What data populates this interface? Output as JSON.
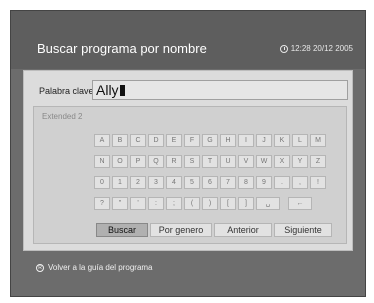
{
  "header": {
    "title": "Buscar programa por nombre",
    "datetime": "12:28 20/12 2005"
  },
  "keyword": {
    "label": "Palabra clave",
    "value": "Ally"
  },
  "keyboard": {
    "mode": "Extended 2",
    "rows": [
      [
        "A",
        "B",
        "C",
        "D",
        "E",
        "F",
        "G",
        "H",
        "I",
        "J",
        "K",
        "L",
        "M"
      ],
      [
        "N",
        "O",
        "P",
        "Q",
        "R",
        "S",
        "T",
        "U",
        "V",
        "W",
        "X",
        "Y",
        "Z"
      ],
      [
        "0",
        "1",
        "2",
        "3",
        "4",
        "5",
        "6",
        "7",
        "8",
        "9",
        ".",
        ",",
        "!"
      ],
      [
        "?",
        "\"",
        "'",
        ":",
        ";",
        "(",
        ")",
        "[",
        "]",
        "␣",
        "←"
      ]
    ]
  },
  "buttons": [
    "Buscar",
    "Por genero",
    "Anterior",
    "Siguiente"
  ],
  "footer": {
    "back_label": "Volver a la guía del programa"
  }
}
